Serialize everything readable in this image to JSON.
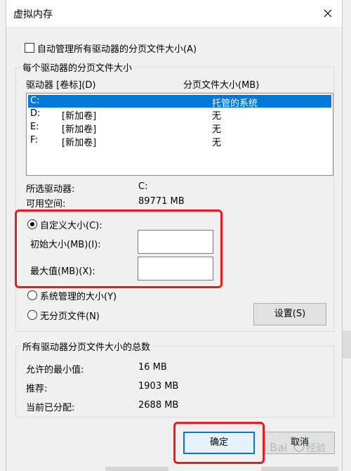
{
  "window": {
    "title": "虚拟内存",
    "close_icon": "close-icon"
  },
  "auto_manage": {
    "label": "自动管理所有驱动器的分页文件大小(A)",
    "checked": false
  },
  "drives_group": {
    "title": "每个驱动器的分页文件大小",
    "col_drive": "驱动器 [卷标](D)",
    "col_size": "分页文件大小(MB)",
    "rows": [
      {
        "drive": "C:",
        "label": "",
        "size": "托管的系统",
        "selected": true
      },
      {
        "drive": "D:",
        "label": "[新加卷]",
        "size": "无",
        "selected": false
      },
      {
        "drive": "E:",
        "label": "[新加卷]",
        "size": "无",
        "selected": false
      },
      {
        "drive": "F:",
        "label": "[新加卷]",
        "size": "无",
        "selected": false
      }
    ],
    "selected_drive_label": "所选驱动器:",
    "selected_drive_value": "C:",
    "free_space_label": "可用空间:",
    "free_space_value": "89771 MB",
    "custom_size_label": "自定义大小(C):",
    "initial_size_label": "初始大小(MB)(I):",
    "initial_size_value": "",
    "max_size_label": "最大值(MB)(X):",
    "max_size_value": "",
    "system_managed_label": "系统管理的大小(Y)",
    "no_paging_label": "无分页文件(N)",
    "set_button": "设置(S)"
  },
  "totals_group": {
    "title": "所有驱动器分页文件大小的总数",
    "min_label": "允许的最小值:",
    "min_value": "16 MB",
    "recommended_label": "推荐:",
    "recommended_value": "1903 MB",
    "current_label": "当前已分配:",
    "current_value": "2688 MB"
  },
  "buttons": {
    "ok": "确定",
    "cancel": "取消"
  },
  "colors": {
    "accent": "#0078d7",
    "highlight_box": "#e31f1f"
  }
}
